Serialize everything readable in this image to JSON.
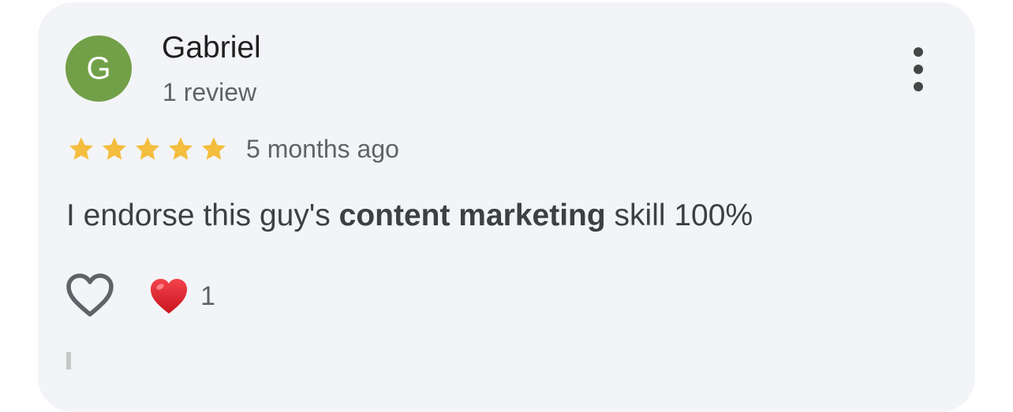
{
  "review": {
    "avatar_letter": "G",
    "avatar_color": "#72a048",
    "author_name": "Gabriel",
    "review_count": "1 review",
    "rating": 5,
    "rating_max": 5,
    "star_color": "#f4bd3e",
    "timestamp": "5 months ago",
    "text_before": "I endorse this guy's ",
    "text_bold": "content marketing",
    "text_after": " skill 100%",
    "like_icon": "heart-outline-icon",
    "reaction_icon": "red-heart-icon",
    "reaction_count": "1",
    "more_icon": "more-vertical-icon"
  }
}
